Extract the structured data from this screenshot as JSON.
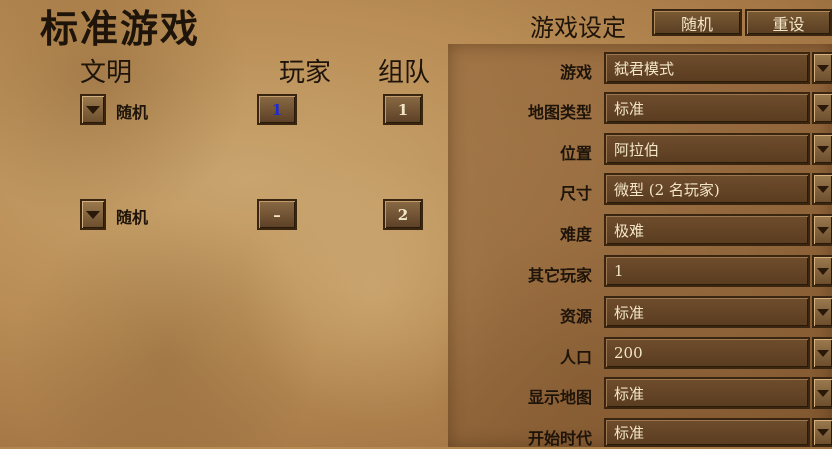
{
  "title": "标准游戏",
  "settings": {
    "label": "游戏设定",
    "random_button": "随机",
    "reset_button": "重设"
  },
  "columns": {
    "civ": "文明",
    "player": "玩家",
    "team": "组队"
  },
  "players": [
    {
      "civ": "随机",
      "player": "1",
      "team": "1"
    },
    {
      "civ": "随机",
      "player": "–",
      "team": "2"
    }
  ],
  "game_settings": [
    {
      "label": "游戏",
      "value": "弑君模式"
    },
    {
      "label": "地图类型",
      "value": "标准"
    },
    {
      "label": "位置",
      "value": "阿拉伯"
    },
    {
      "label": "尺寸",
      "value": "微型 (2 名玩家)"
    },
    {
      "label": "难度",
      "value": "极难"
    },
    {
      "label": "其它玩家",
      "value": "1"
    },
    {
      "label": "资源",
      "value": "标准"
    },
    {
      "label": "人口",
      "value": "200"
    },
    {
      "label": "显示地图",
      "value": "标准"
    },
    {
      "label": "开始时代",
      "value": "标准"
    }
  ],
  "icons": {
    "dropdown": "chevron-down-icon"
  },
  "colors": {
    "player1_number": "#1b2bd0",
    "text_dark": "#1e140a",
    "text_light": "#f3e6c8"
  }
}
